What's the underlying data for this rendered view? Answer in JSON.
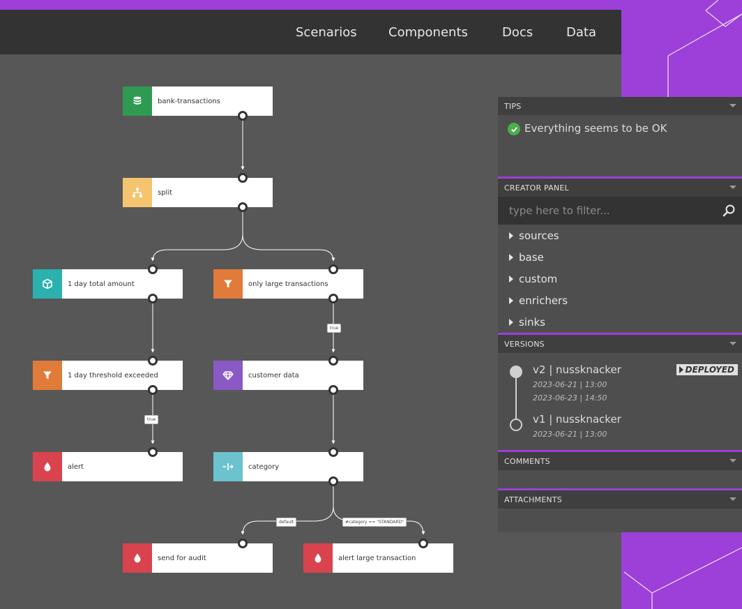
{
  "nav": {
    "items": [
      "Scenarios",
      "Components",
      "Docs",
      "Data"
    ]
  },
  "colors": {
    "source": "#2e9a52",
    "split": "#f5c46e",
    "aggregate": "#2bb1ae",
    "filter": "#e07b39",
    "enricher": "#8a59c6",
    "switch": "#6cc3cf",
    "sink": "#d9434e"
  },
  "nodes": {
    "bank_transactions": {
      "label": "bank-transactions",
      "icon": "database-icon"
    },
    "split": {
      "label": "split",
      "icon": "split-icon"
    },
    "day_total": {
      "label": "1 day total amount",
      "icon": "cube-icon"
    },
    "only_large": {
      "label": "only large transactions",
      "icon": "filter-icon"
    },
    "threshold": {
      "label": "1 day threshold exceeded",
      "icon": "filter-icon"
    },
    "customer_data": {
      "label": "customer data",
      "icon": "gem-icon"
    },
    "alert": {
      "label": "alert",
      "icon": "drop-icon"
    },
    "category": {
      "label": "category",
      "icon": "switch-icon"
    },
    "send_audit": {
      "label": "send for audit",
      "icon": "drop-icon"
    },
    "alert_large": {
      "label": "alert large transaction",
      "icon": "drop-icon"
    }
  },
  "edge_labels": {
    "true_1": "true",
    "true_2": "true",
    "default": "default",
    "standard": "#category == \"STANDARD\""
  },
  "panels": {
    "tips": {
      "title": "TIPS",
      "message": "Everything seems to be OK"
    },
    "creator": {
      "title": "CREATOR PANEL",
      "filter_placeholder": "type here to filter...",
      "groups": [
        "sources",
        "base",
        "custom",
        "enrichers",
        "sinks"
      ]
    },
    "versions": {
      "title": "VERSIONS",
      "items": [
        {
          "title": "v2 | nussknacker",
          "dates": [
            "2023-06-21 | 13:00",
            "2023-06-23 | 14:50"
          ],
          "badge": "DEPLOYED"
        },
        {
          "title": "v1 | nussknacker",
          "dates": [
            "2023-06-21 | 13:00"
          ]
        }
      ]
    },
    "comments": {
      "title": "COMMENTS"
    },
    "attachments": {
      "title": "ATTACHMENTS"
    }
  }
}
